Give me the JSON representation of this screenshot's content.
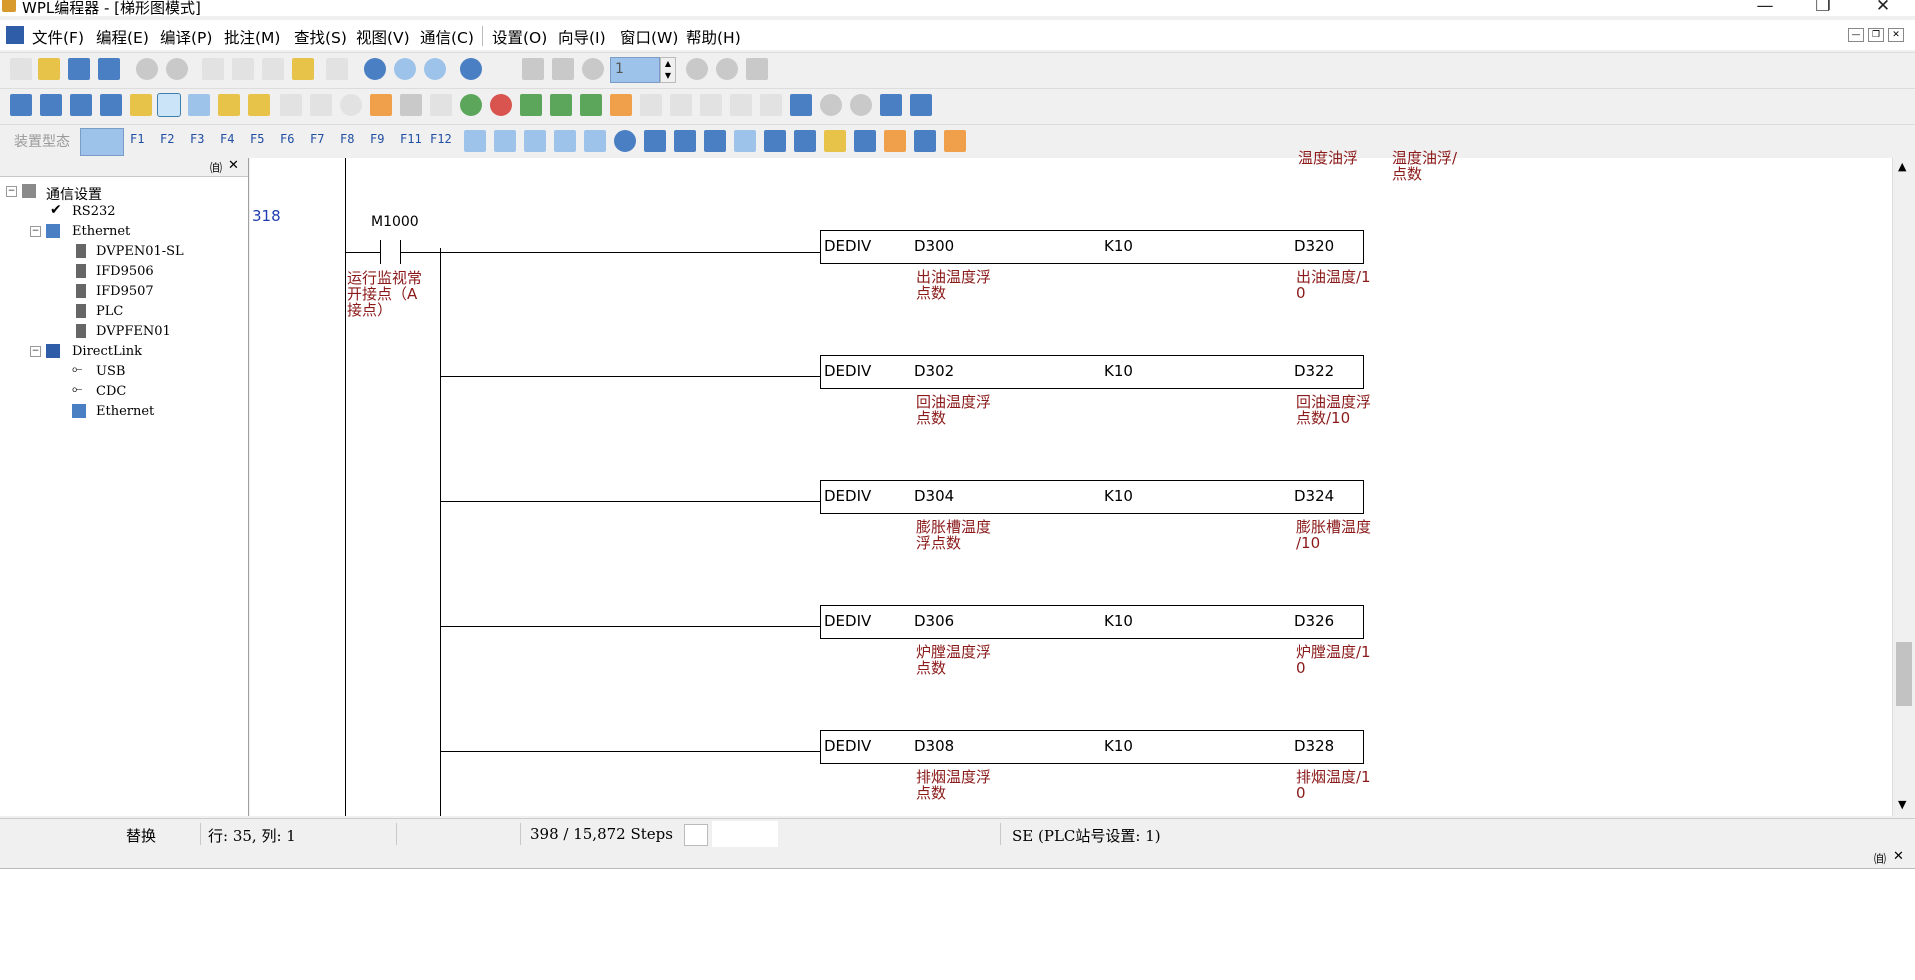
{
  "window": {
    "title": "WPL编程器 - [梯形图模式]"
  },
  "menu": [
    "文件(F)",
    "编程(E)",
    "编译(P)",
    "批注(M)",
    "查找(S)",
    "视图(V)",
    "通信(C)",
    "设置(O)",
    "向导(I)",
    "窗口(W)",
    "帮助(H)"
  ],
  "toolbar": {
    "step_value": "1",
    "device_type_label": "装置型态",
    "fkeys": [
      "F1",
      "F2",
      "F3",
      "F4",
      "F5",
      "F6",
      "F7",
      "F8",
      "F9",
      "F11",
      "F12"
    ]
  },
  "tree": {
    "root": "通信设置",
    "rs232": "RS232",
    "ethernet": "Ethernet",
    "ethernet_children": [
      "DVPEN01-SL",
      "IFD9506",
      "IFD9507",
      "PLC",
      "DVPFEN01"
    ],
    "directlink": "DirectLink",
    "directlink_children": [
      "USB",
      "CDC",
      "Ethernet"
    ]
  },
  "ladder": {
    "top_partial_left": "温度油浮",
    "top_partial_right": "温度油浮/\n点数",
    "step": "318",
    "contact_device": "M1000",
    "contact_comment": "运行监视常\n开接点（A\n接点）",
    "rungs": [
      {
        "op": "DEDIV",
        "s1": "D300",
        "s2": "K10",
        "d": "D320",
        "c1": "出油温度浮\n点数",
        "cd": "出油温度/1\n0"
      },
      {
        "op": "DEDIV",
        "s1": "D302",
        "s2": "K10",
        "d": "D322",
        "c1": "回油温度浮\n点数",
        "cd": "回油温度浮\n点数/10"
      },
      {
        "op": "DEDIV",
        "s1": "D304",
        "s2": "K10",
        "d": "D324",
        "c1": "膨胀槽温度\n浮点数",
        "cd": "膨胀槽温度\n/10"
      },
      {
        "op": "DEDIV",
        "s1": "D306",
        "s2": "K10",
        "d": "D326",
        "c1": "炉膛温度浮\n点数",
        "cd": "炉膛温度/1\n0"
      },
      {
        "op": "DEDIV",
        "s1": "D308",
        "s2": "K10",
        "d": "D328",
        "c1": "排烟温度浮\n点数",
        "cd": "排烟温度/1\n0"
      }
    ]
  },
  "status": {
    "mode": "替换",
    "position": "行: 35, 列: 1",
    "steps": "398 / 15,872 Steps",
    "station": "SE (PLC站号设置: 1)"
  }
}
